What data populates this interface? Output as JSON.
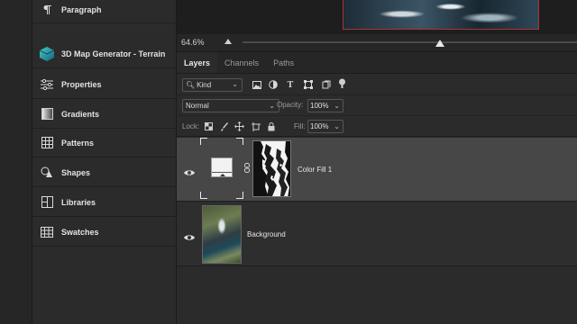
{
  "dock": {
    "items": [
      {
        "label": "Paragraph",
        "icon": "paragraph-icon"
      },
      {
        "label": "3D Map Generator - Terrain",
        "icon": "terrain-icon"
      },
      {
        "label": "Properties",
        "icon": "properties-icon"
      },
      {
        "label": "Gradients",
        "icon": "gradients-icon"
      },
      {
        "label": "Patterns",
        "icon": "patterns-icon"
      },
      {
        "label": "Shapes",
        "icon": "shapes-icon"
      },
      {
        "label": "Libraries",
        "icon": "libraries-icon"
      },
      {
        "label": "Swatches",
        "icon": "swatches-icon"
      }
    ]
  },
  "zoom": {
    "value": "64.6%",
    "slider_fraction": 0.59
  },
  "layers_panel": {
    "tabs": [
      "Layers",
      "Channels",
      "Paths"
    ],
    "active_tab": "Layers",
    "filter": {
      "kind_label": "Kind",
      "icons": [
        "image-filter-icon",
        "adjustment-filter-icon",
        "type-filter-icon",
        "shape-filter-icon",
        "smart-object-filter-icon",
        "filter-toggle-icon"
      ]
    },
    "blend_mode": "Normal",
    "opacity_label": "Opacity:",
    "opacity": "100%",
    "lock_label": "Lock:",
    "lock_icons": [
      "lock-transparent-icon",
      "lock-paint-icon",
      "lock-position-icon",
      "lock-artboard-icon",
      "lock-all-icon"
    ],
    "fill_label": "Fill:",
    "fill": "100%",
    "layers": [
      {
        "name": "Color Fill 1",
        "selected": true
      },
      {
        "name": "Background",
        "selected": false
      }
    ]
  },
  "colors": {
    "selection": "#474747",
    "panel": "#2b2b2b",
    "canvas_border": "#aa3333"
  }
}
